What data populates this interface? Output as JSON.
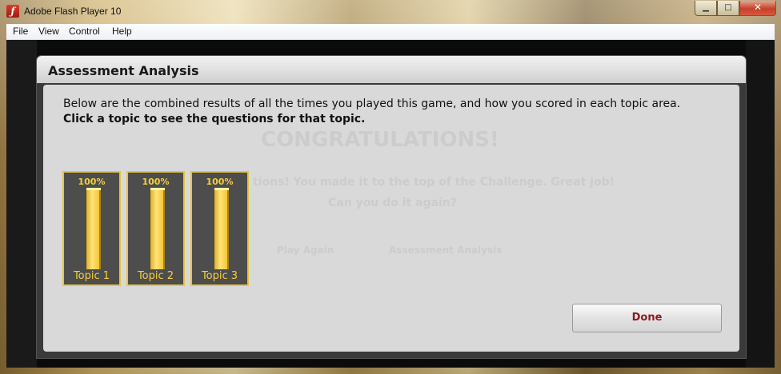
{
  "window": {
    "title": "Adobe Flash Player 10",
    "app_icon": "flash-icon",
    "buttons": {
      "minimize": "minimize-icon",
      "maximize": "maximize-icon",
      "close": "close-icon"
    }
  },
  "menu": [
    "File",
    "View",
    "Control",
    "Help"
  ],
  "background_game": {
    "heading": "CONGRATULATIONS!",
    "line1": "tions! You made it to the top of the Challenge. Great job!",
    "line2": "Can you do it again?",
    "btn1": "Play Again",
    "btn2": "Assessment Analysis"
  },
  "dialog": {
    "title": "Assessment Analysis",
    "intro": "Below are the combined results of all the times you played this game, and how you scored in each topic area.",
    "instruction": "Click a topic to see the questions for that topic.",
    "topics": [
      {
        "label": "Topic 1",
        "percent_text": "100%",
        "percent": 100
      },
      {
        "label": "Topic 2",
        "percent_text": "100%",
        "percent": 100
      },
      {
        "label": "Topic 3",
        "percent_text": "100%",
        "percent": 100
      }
    ],
    "done_label": "Done"
  },
  "colors": {
    "accent_gold": "#f5cf3c",
    "topic_bg": "#4d4d4d",
    "done_text": "#8b1c1c"
  }
}
